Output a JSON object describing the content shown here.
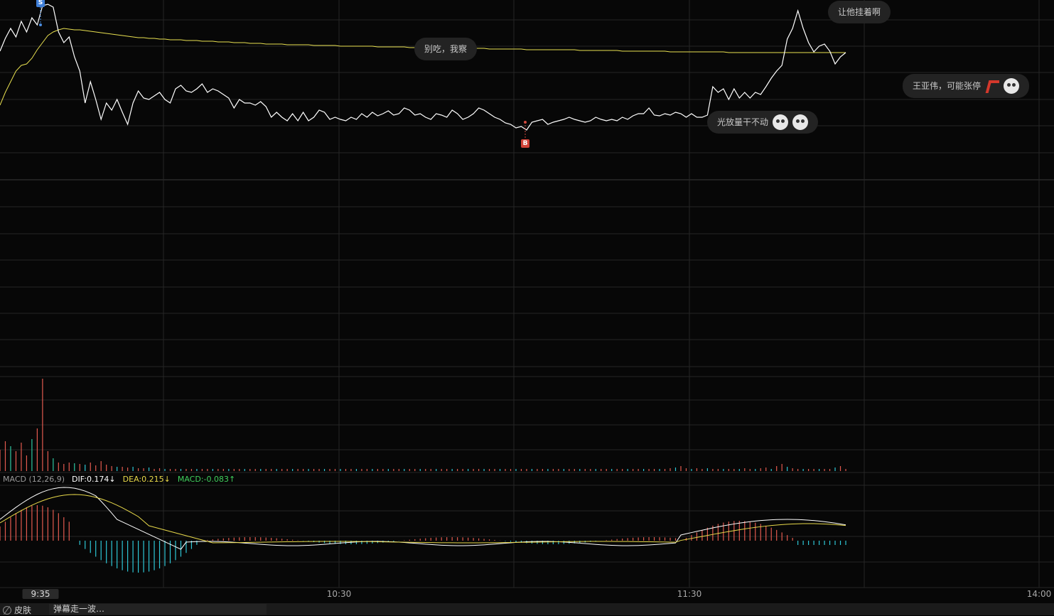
{
  "chart_data": {
    "type": "line",
    "price_series": {
      "white": [
        72,
        54,
        40,
        52,
        30,
        45,
        25,
        35,
        8,
        6,
        10,
        45,
        60,
        52,
        80,
        100,
        145,
        115,
        140,
        168,
        145,
        155,
        140,
        158,
        175,
        145,
        128,
        138,
        140,
        135,
        130,
        140,
        145,
        125,
        120,
        128,
        130,
        125,
        118,
        130,
        125,
        128,
        133,
        138,
        152,
        140,
        145,
        145,
        148,
        143,
        150,
        165,
        158,
        165,
        170,
        160,
        170,
        158,
        170,
        165,
        155,
        158,
        168,
        165,
        168,
        170,
        165,
        168,
        160,
        165,
        158,
        163,
        160,
        156,
        162,
        160,
        152,
        155,
        162,
        160,
        165,
        168,
        160,
        162,
        165,
        155,
        160,
        168,
        165,
        160,
        152,
        155,
        160,
        165,
        168,
        173,
        175,
        180,
        178,
        183,
        172,
        170,
        168,
        175,
        172,
        170,
        168,
        165,
        168,
        170,
        172,
        170,
        165,
        168,
        170,
        168,
        170,
        165,
        168,
        163,
        160,
        160,
        152,
        162,
        163,
        160,
        162,
        158,
        160,
        165,
        160,
        165,
        165,
        162,
        122,
        130,
        125,
        140,
        125,
        138,
        130,
        138,
        130,
        133,
        122,
        110,
        100,
        92,
        55,
        40,
        15,
        40,
        60,
        73,
        65,
        62,
        72,
        90,
        80,
        74
      ],
      "yellow": [
        148,
        130,
        115,
        100,
        92,
        90,
        82,
        70,
        60,
        50,
        45,
        42,
        40,
        41,
        42,
        42,
        43,
        44,
        45,
        46,
        47,
        48,
        49,
        50,
        51,
        52,
        53,
        53,
        54,
        54,
        55,
        55,
        56,
        56,
        56,
        57,
        57,
        57,
        58,
        58,
        58,
        59,
        59,
        59,
        60,
        60,
        60,
        61,
        61,
        61,
        62,
        62,
        62,
        62,
        63,
        63,
        63,
        63,
        63,
        64,
        64,
        64,
        64,
        64,
        65,
        65,
        65,
        65,
        65,
        65,
        65,
        66,
        66,
        66,
        66,
        66,
        66,
        67,
        67,
        67,
        67,
        67,
        67,
        67,
        68,
        68,
        68,
        68,
        68,
        68,
        68,
        68,
        69,
        69,
        69,
        69,
        69,
        69,
        69,
        70,
        70,
        70,
        70,
        70,
        70,
        70,
        70,
        70,
        70,
        71,
        71,
        71,
        71,
        71,
        71,
        71,
        71,
        72,
        72,
        72,
        72,
        72,
        72,
        72,
        72,
        72,
        73,
        73,
        73,
        73,
        73,
        73,
        73,
        73,
        73,
        73,
        73,
        74,
        74,
        74,
        74,
        74,
        74,
        74,
        74,
        74,
        74,
        74,
        74,
        74,
        74,
        74,
        74,
        74,
        74,
        74,
        74,
        74,
        74,
        74
      ]
    },
    "volume": [
      30,
      42,
      35,
      28,
      40,
      22,
      45,
      60,
      130,
      28,
      18,
      12,
      10,
      12,
      11,
      10,
      9,
      12,
      8,
      14,
      9,
      7,
      6,
      6,
      5,
      6,
      4,
      4,
      5,
      3,
      4,
      3,
      3,
      3,
      3,
      3,
      3,
      3,
      3,
      3,
      3,
      3,
      3,
      3,
      3,
      3,
      3,
      3,
      3,
      3,
      3,
      3,
      3,
      3,
      3,
      3,
      3,
      3,
      3,
      3,
      3,
      3,
      3,
      3,
      3,
      3,
      3,
      3,
      3,
      3,
      3,
      3,
      3,
      3,
      3,
      3,
      3,
      3,
      3,
      3,
      3,
      3,
      3,
      3,
      3,
      3,
      3,
      3,
      3,
      3,
      3,
      3,
      3,
      3,
      3,
      3,
      3,
      3,
      3,
      3,
      3,
      3,
      3,
      3,
      3,
      3,
      3,
      3,
      3,
      3,
      3,
      3,
      3,
      3,
      3,
      3,
      3,
      3,
      3,
      3,
      3,
      3,
      3,
      3,
      3,
      3,
      4,
      5,
      7,
      4,
      3,
      4,
      3,
      4,
      3,
      3,
      3,
      3,
      3,
      3,
      4,
      3,
      3,
      4,
      5,
      3,
      7,
      10,
      6,
      4,
      3,
      3,
      3,
      3,
      3,
      3,
      3,
      5,
      7,
      3
    ],
    "volume_colors": "mixed",
    "macd": {
      "label": "MACD (12,26,9)",
      "dif": "DIF:0.174↓",
      "dea": "DEA:0.215↓",
      "macd": "MACD:-0.083↑"
    },
    "x_ticks": [
      "9:35",
      "10:30",
      "11:30",
      "14:00"
    ]
  },
  "danmu": [
    {
      "text": "让他挂着啊",
      "decor": ""
    },
    {
      "text": "别吃，我察",
      "decor": ""
    },
    {
      "text": "王亚伟，可能张停",
      "decor": "flag-emoji"
    },
    {
      "text": "光放量干不动",
      "decor": "emoji-emoji"
    }
  ],
  "markers": {
    "sell": "S",
    "buy": "B"
  },
  "bottom": {
    "skin": "皮肤",
    "danmu_prompt": "弹幕走一波…"
  },
  "colors": {
    "price": "#ffffff",
    "avg": "#e8e050",
    "up": "#e35a4f",
    "down": "#2ec7d6",
    "dif": "#ffffff",
    "dea": "#e8d94a",
    "macd_label": "#3fcf5c",
    "grid": "#262626"
  }
}
